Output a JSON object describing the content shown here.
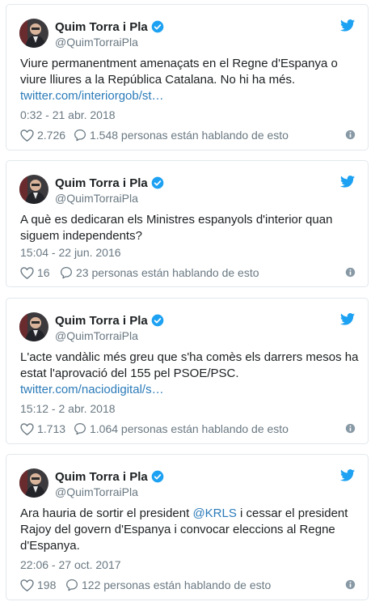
{
  "colors": {
    "link": "#2b7bb9",
    "verified": "#1da1f2",
    "muted": "#697882",
    "border": "#e1e8ed"
  },
  "icons": {
    "verified": "verified-badge-icon",
    "logo": "twitter-bird-icon",
    "like": "heart-icon",
    "reply": "speech-bubble-icon",
    "info": "info-icon"
  },
  "tweets": [
    {
      "name": "Quim Torra i Pla",
      "handle": "@QuimTorraiPla",
      "text_lines": [
        "Viure permanentment amenaçats en el Regne d'Espanya o",
        "viure lliures a la República Catalana. No hi ha més."
      ],
      "link": "twitter.com/interiorgob/st…",
      "time": "0:32 - 21 abr. 2018",
      "likes": "2.726",
      "talking": "1.548 personas están hablando de esto"
    },
    {
      "name": "Quim Torra i Pla",
      "handle": "@QuimTorraiPla",
      "text_lines": [
        "A què es dedicaran els Ministres espanyols d'interior quan",
        "siguem independents?"
      ],
      "time": "15:04 - 22 jun. 2016",
      "likes": "16",
      "talking": "23 personas están hablando de esto"
    },
    {
      "name": "Quim Torra i Pla",
      "handle": "@QuimTorraiPla",
      "text_lines": [
        "L'acte vandàlic més greu que s'ha comès els darrers mesos ha",
        "estat l'aprovació del 155 pel PSOE/PSC."
      ],
      "link": "twitter.com/naciodigital/s…",
      "time": "15:12 - 2 abr. 2018",
      "likes": "1.713",
      "talking": "1.064 personas están hablando de esto"
    },
    {
      "name": "Quim Torra i Pla",
      "handle": "@QuimTorraiPla",
      "text_before_mention": "Ara hauria de sortir el president ",
      "mention": "@KRLS",
      "text_after_mention": " i cessar el president",
      "text_lines": [
        "Rajoy del govern d'Espanya i convocar eleccions al Regne",
        "d'Espanya."
      ],
      "time": "22:06 - 27 oct. 2017",
      "likes": "198",
      "talking": "122 personas están hablando de esto"
    }
  ]
}
